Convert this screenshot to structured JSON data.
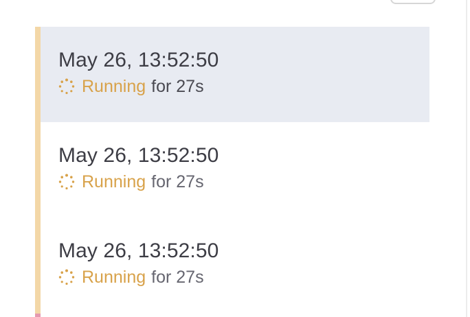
{
  "runs": [
    {
      "time": "May 26, 13:52:50",
      "status": "Running",
      "duration": "for 27s",
      "selected": true
    },
    {
      "time": "May 26, 13:52:50",
      "status": "Running",
      "duration": "for 27s",
      "selected": false
    },
    {
      "time": "May 26, 13:52:50",
      "status": "Running",
      "duration": "for 27s",
      "selected": false
    }
  ],
  "colors": {
    "selected_background": "#e8ebf2",
    "running_status": "#d8a24a",
    "timeline_accent": "#f3d7a7",
    "timeline_bottom_accent": "#e59ab1",
    "primary_text": "#3d3d45",
    "secondary_text": "#666670"
  },
  "icons": {
    "running_status": "loading-spinner-icon",
    "top_control": "partial-button"
  }
}
